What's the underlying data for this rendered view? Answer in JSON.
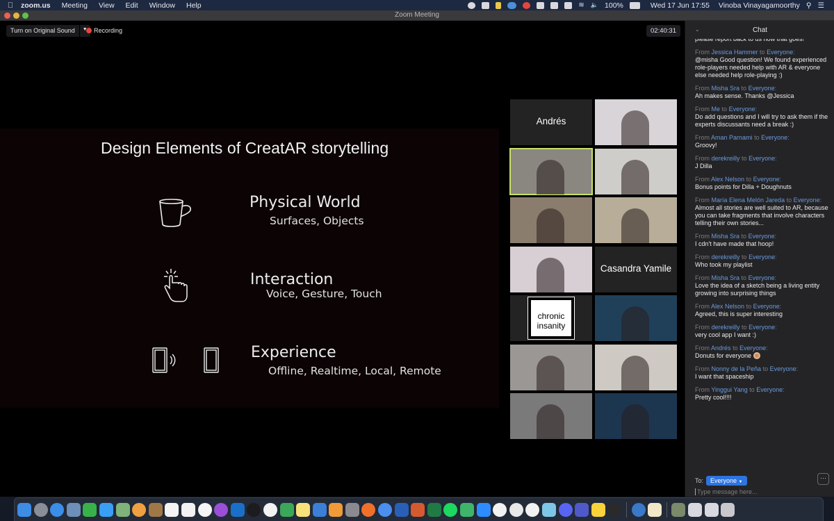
{
  "menubar": {
    "app_name": "zoom.us",
    "menus": [
      "Meeting",
      "View",
      "Edit",
      "Window",
      "Help"
    ],
    "battery": "100%",
    "datetime": "Wed 17 Jun  17:55",
    "user": "Vinoba  Vinayagamoorthy"
  },
  "window": {
    "title": "Zoom Meeting"
  },
  "meeting": {
    "original_sound_label": "Turn on Original Sound",
    "recording_label": "Recording",
    "timer": "02:40:31"
  },
  "slide": {
    "title": "Design Elements of CreatAR storytelling",
    "features": [
      {
        "heading": "Physical World",
        "sub": "Surfaces, Objects",
        "icon": "cup-icon"
      },
      {
        "heading": "Interaction",
        "sub": "Voice, Gesture, Touch",
        "icon": "tap-hand-icon"
      },
      {
        "heading": "Experience",
        "sub": "Offline, Realtime, Local, Remote",
        "icon": "phones-icon"
      }
    ]
  },
  "gallery": {
    "tiles": [
      {
        "name": "Andrés",
        "type": "name-only"
      },
      {
        "name": "",
        "type": "video",
        "bg": "#d9d4d8"
      },
      {
        "name": "",
        "type": "video",
        "bg": "#8a8780",
        "active": true
      },
      {
        "name": "",
        "type": "video",
        "bg": "#cfcdca"
      },
      {
        "name": "",
        "type": "video",
        "bg": "#8a7d6e"
      },
      {
        "name": "",
        "type": "video",
        "bg": "#b7ad98"
      },
      {
        "name": "",
        "type": "video",
        "bg": "#d8cfd5"
      },
      {
        "name": "Casandra Yamile",
        "type": "name-only"
      },
      {
        "name": "chronic insanity",
        "type": "logo"
      },
      {
        "name": "",
        "type": "video",
        "bg": "#20405a"
      },
      {
        "name": "",
        "type": "video",
        "bg": "#9a9794"
      },
      {
        "name": "",
        "type": "video",
        "bg": "#cfc9c3"
      },
      {
        "name": "",
        "type": "video",
        "bg": "#7a7a7a"
      },
      {
        "name": "",
        "type": "video",
        "bg": "#1c3650"
      }
    ]
  },
  "chat": {
    "title": "Chat",
    "cut_line": "please report back to us how that goes!",
    "messages": [
      {
        "from": "Jessica Hammer",
        "to": "Everyone",
        "text": "@misha Good question! We found experienced role-players needed help with AR & everyone else needed help role-playing :)"
      },
      {
        "from": "Misha Sra",
        "to": "Everyone",
        "text": "Ah makes sense. Thanks @Jessica"
      },
      {
        "from": "Me",
        "to": "Everyone",
        "text": "Do add questions and I will try to ask them if the experts discussants need a break :)"
      },
      {
        "from": "Aman Parnami",
        "to": "Everyone",
        "text": "Groovy!"
      },
      {
        "from": "derekreilly",
        "to": "Everyone",
        "text": "J Dilla"
      },
      {
        "from": "Alex Nelson",
        "to": "Everyone",
        "text": "Bonus points for Dilla + Doughnuts"
      },
      {
        "from": "María Elena Melón Jareda",
        "to": "Everyone",
        "text": "Almost all stories are well suited to AR, because you can take fragments that involve characters telling their own stories..."
      },
      {
        "from": "Misha Sra",
        "to": "Everyone",
        "text": "I cdn't have made that hoop!"
      },
      {
        "from": "derekreilly",
        "to": "Everyone",
        "text": "Who took my playlist"
      },
      {
        "from": "Misha Sra",
        "to": "Everyone",
        "text": "Love the idea of a sketch being a living entity growing into surprising things"
      },
      {
        "from": "Alex Nelson",
        "to": "Everyone",
        "text": "Agreed, this is super interesting"
      },
      {
        "from": "derekreilly",
        "to": "Everyone",
        "text": "very cool app I want :)"
      },
      {
        "from": "Andrés",
        "to": "Everyone",
        "text": "Donuts for everyone",
        "emoji": "donut"
      },
      {
        "from": "Nonny de la Peña",
        "to": "Everyone",
        "text": "I want that spaceship"
      },
      {
        "from": "Yinggui Yang",
        "to": "Everyone",
        "text": "Pretty cool!!!!"
      }
    ],
    "from_word": "From",
    "to_word": "to",
    "to_label": "To:",
    "recipient": "Everyone",
    "more_label": "···",
    "input_placeholder": "Type message here..."
  },
  "dock": {
    "apps": [
      {
        "name": "finder",
        "color": "#3d8ce6"
      },
      {
        "name": "launchpad",
        "color": "#8a8e96"
      },
      {
        "name": "safari",
        "color": "#3a8ee8"
      },
      {
        "name": "preview",
        "color": "#6d8fb8"
      },
      {
        "name": "facetime",
        "color": "#37b34a"
      },
      {
        "name": "messages",
        "color": "#3a9ef5"
      },
      {
        "name": "maps",
        "color": "#7fb37a"
      },
      {
        "name": "photos",
        "color": "#f0a040"
      },
      {
        "name": "contacts",
        "color": "#a07848"
      },
      {
        "name": "calendar",
        "color": "#f4f4f4"
      },
      {
        "name": "reminders",
        "color": "#f2f2f2"
      },
      {
        "name": "music",
        "color": "#f5f5f7"
      },
      {
        "name": "podcasts",
        "color": "#9a4fd6"
      },
      {
        "name": "outlook",
        "color": "#1a70c8"
      },
      {
        "name": "apple-tv",
        "color": "#1c1c1e"
      },
      {
        "name": "news",
        "color": "#f2f2f2"
      },
      {
        "name": "numbers",
        "color": "#3aa858"
      },
      {
        "name": "notes",
        "color": "#f7e27a"
      },
      {
        "name": "keynote",
        "color": "#3b7fd6"
      },
      {
        "name": "pages",
        "color": "#f09a38"
      },
      {
        "name": "system-preferences",
        "color": "#8a8a90"
      },
      {
        "name": "firefox",
        "color": "#f0702a"
      },
      {
        "name": "chrome",
        "color": "#4a8ef0"
      },
      {
        "name": "word",
        "color": "#2a5fb8"
      },
      {
        "name": "powerpoint",
        "color": "#d65a30"
      },
      {
        "name": "excel",
        "color": "#1f7a44"
      },
      {
        "name": "spotify",
        "color": "#1ed760"
      },
      {
        "name": "gitkraken",
        "color": "#3fb56a"
      },
      {
        "name": "zoom",
        "color": "#2d8cff"
      },
      {
        "name": "slack",
        "color": "#f2f2f2"
      },
      {
        "name": "creative-cloud",
        "color": "#e8e8e8"
      },
      {
        "name": "miro-app",
        "color": "#f2f2f2"
      },
      {
        "name": "notability",
        "color": "#7ec6e8"
      },
      {
        "name": "discord",
        "color": "#5865f2"
      },
      {
        "name": "teams",
        "color": "#5059c9"
      },
      {
        "name": "miro",
        "color": "#f7d23a"
      },
      {
        "name": "unknown-app",
        "color": "#2a2a2a"
      },
      {
        "name": "separator"
      },
      {
        "name": "quicktime",
        "color": "#3a78c8"
      },
      {
        "name": "textedit",
        "color": "#f2e8c8"
      },
      {
        "name": "separator"
      },
      {
        "name": "downloads",
        "color": "#7a8a6a"
      },
      {
        "name": "document-1",
        "color": "#d8d8e0"
      },
      {
        "name": "document-2",
        "color": "#d8d8e0"
      },
      {
        "name": "trash",
        "color": "#c8c8cc"
      }
    ]
  }
}
